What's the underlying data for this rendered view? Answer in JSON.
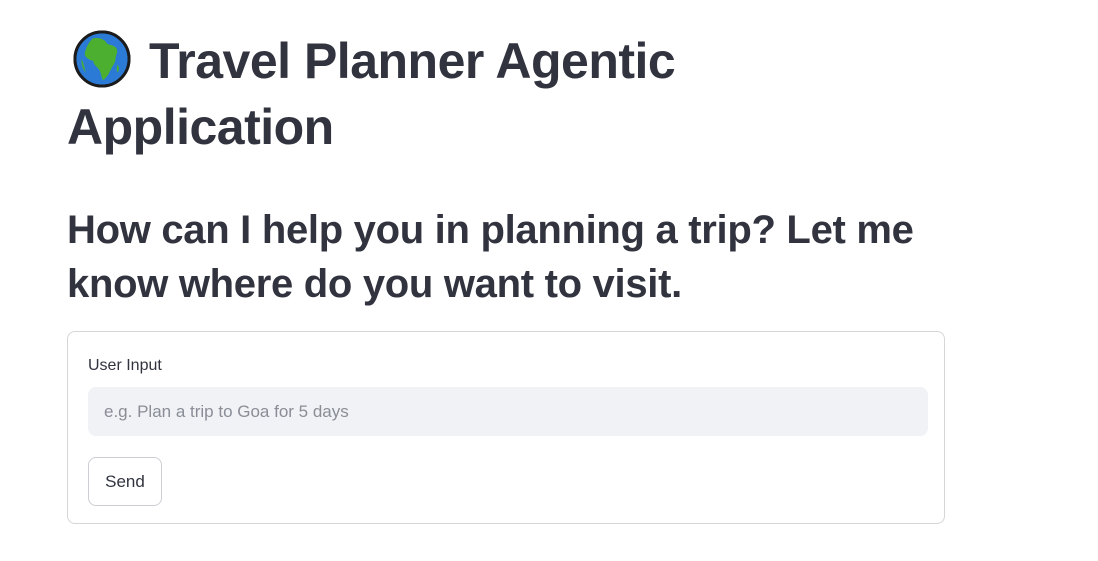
{
  "header": {
    "icon": "globe-africa-icon",
    "title": "Travel Planner Agentic Application"
  },
  "prompt": {
    "text": "How can I help you in planning a trip? Let me know where do you want to visit."
  },
  "form": {
    "input_label": "User Input",
    "input_value": "",
    "input_placeholder": "e.g. Plan a trip to Goa for 5 days",
    "submit_label": "Send"
  },
  "colors": {
    "text": "#31333f",
    "input_bg": "#f0f2f6",
    "border": "#d6d6d9",
    "globe_ocean": "#2b7bd6",
    "globe_land": "#4caf2f"
  }
}
